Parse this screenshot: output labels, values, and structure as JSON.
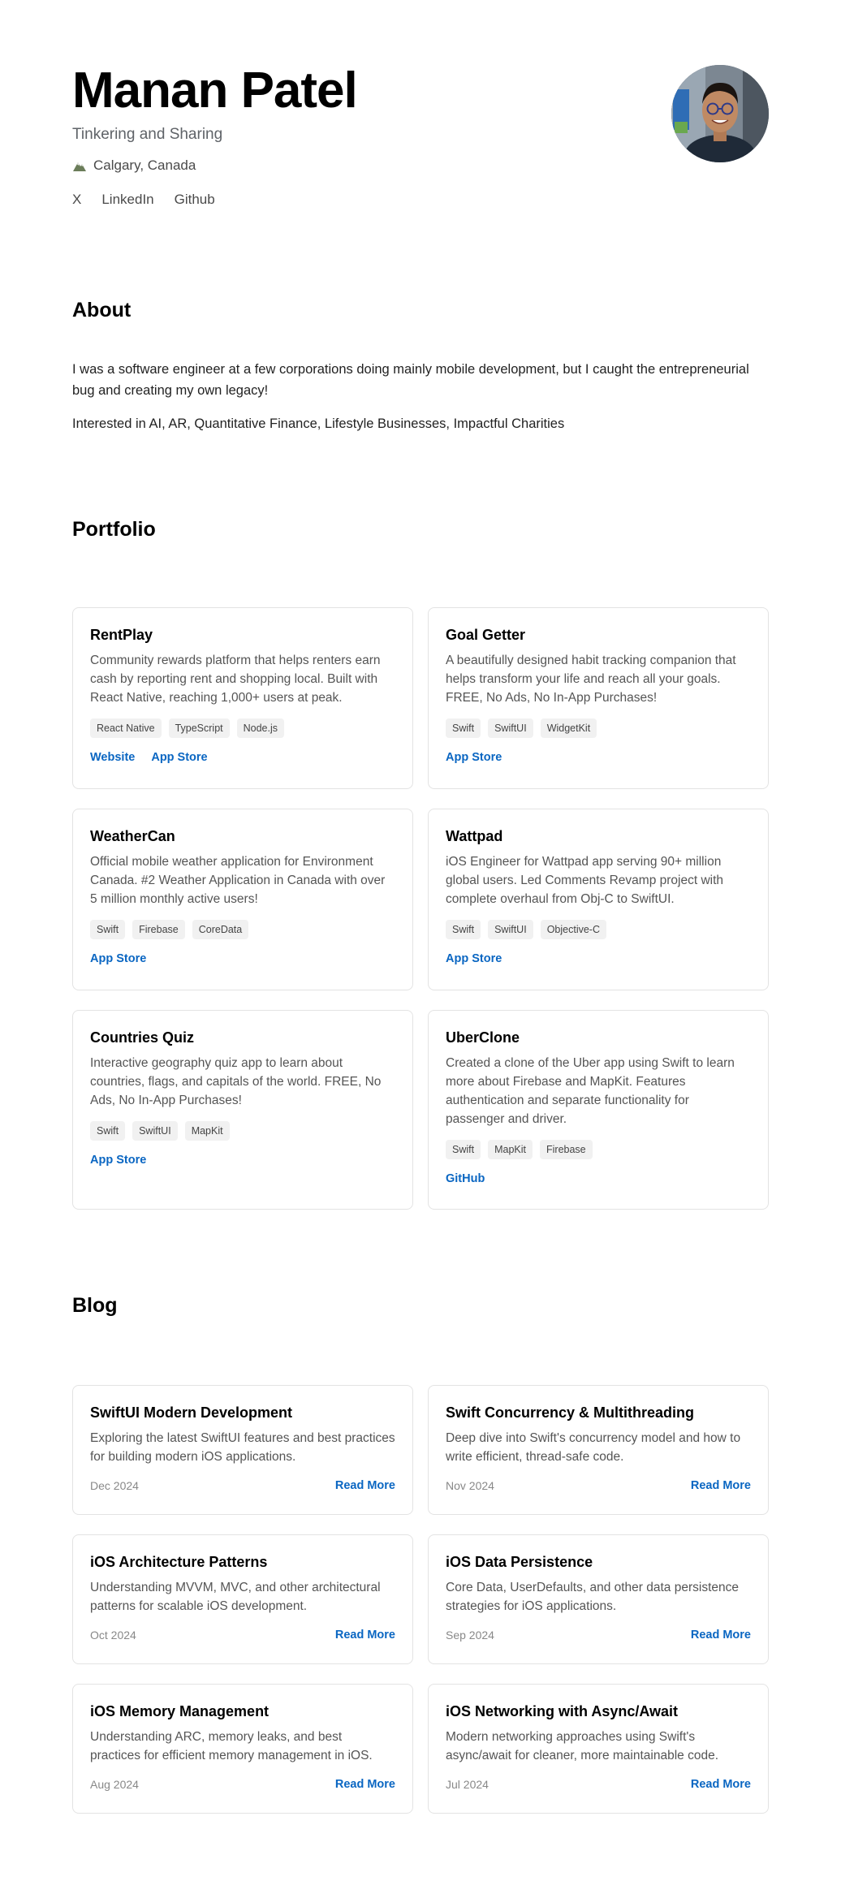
{
  "header": {
    "name": "Manan Patel",
    "tagline": "Tinkering and Sharing",
    "location": "Calgary, Canada",
    "location_icon": "mountain-icon",
    "social": [
      "X",
      "LinkedIn",
      "Github"
    ]
  },
  "about": {
    "title": "About",
    "paragraphs": [
      "I was a software engineer at a few corporations doing mainly mobile development, but I caught the entrepreneurial bug and creating my own legacy!",
      "Interested in AI, AR, Quantitative Finance, Lifestyle Businesses, Impactful Charities"
    ]
  },
  "portfolio": {
    "title": "Portfolio",
    "items": [
      {
        "title": "RentPlay",
        "desc": "Community rewards platform that helps renters earn cash by reporting rent and shopping local. Built with React Native, reaching 1,000+ users at peak.",
        "tags": [
          "React Native",
          "TypeScript",
          "Node.js"
        ],
        "links": [
          "Website",
          "App Store"
        ]
      },
      {
        "title": "Goal Getter",
        "desc": "A beautifully designed habit tracking companion that helps transform your life and reach all your goals. FREE, No Ads, No In-App Purchases!",
        "tags": [
          "Swift",
          "SwiftUI",
          "WidgetKit"
        ],
        "links": [
          "App Store"
        ]
      },
      {
        "title": "WeatherCan",
        "desc": "Official mobile weather application for Environment Canada. #2 Weather Application in Canada with over 5 million monthly active users!",
        "tags": [
          "Swift",
          "Firebase",
          "CoreData"
        ],
        "links": [
          "App Store"
        ]
      },
      {
        "title": "Wattpad",
        "desc": "iOS Engineer for Wattpad app serving 90+ million global users. Led Comments Revamp project with complete overhaul from Obj-C to SwiftUI.",
        "tags": [
          "Swift",
          "SwiftUI",
          "Objective-C"
        ],
        "links": [
          "App Store"
        ]
      },
      {
        "title": "Countries Quiz",
        "desc": "Interactive geography quiz app to learn about countries, flags, and capitals of the world. FREE, No Ads, No In-App Purchases!",
        "tags": [
          "Swift",
          "SwiftUI",
          "MapKit"
        ],
        "links": [
          "App Store"
        ]
      },
      {
        "title": "UberClone",
        "desc": "Created a clone of the Uber app using Swift to learn more about Firebase and MapKit. Features authentication and separate functionality for passenger and driver.",
        "tags": [
          "Swift",
          "MapKit",
          "Firebase"
        ],
        "links": [
          "GitHub"
        ]
      }
    ]
  },
  "blog": {
    "title": "Blog",
    "read_more": "Read More",
    "posts": [
      {
        "title": "SwiftUI Modern Development",
        "desc": "Exploring the latest SwiftUI features and best practices for building modern iOS applications.",
        "date": "Dec 2024"
      },
      {
        "title": "Swift Concurrency & Multithreading",
        "desc": "Deep dive into Swift's concurrency model and how to write efficient, thread-safe code.",
        "date": "Nov 2024"
      },
      {
        "title": "iOS Architecture Patterns",
        "desc": "Understanding MVVM, MVC, and other architectural patterns for scalable iOS development.",
        "date": "Oct 2024"
      },
      {
        "title": "iOS Data Persistence",
        "desc": "Core Data, UserDefaults, and other data persistence strategies for iOS applications.",
        "date": "Sep 2024"
      },
      {
        "title": "iOS Memory Management",
        "desc": "Understanding ARC, memory leaks, and best practices for efficient memory management in iOS.",
        "date": "Aug 2024"
      },
      {
        "title": "iOS Networking with Async/Await",
        "desc": "Modern networking approaches using Swift's async/await for cleaner, more maintainable code.",
        "date": "Jul 2024"
      }
    ]
  },
  "colors": {
    "link": "#0a66c2",
    "card_border": "#e3e3e3",
    "tag_bg": "#f1f1f1"
  }
}
